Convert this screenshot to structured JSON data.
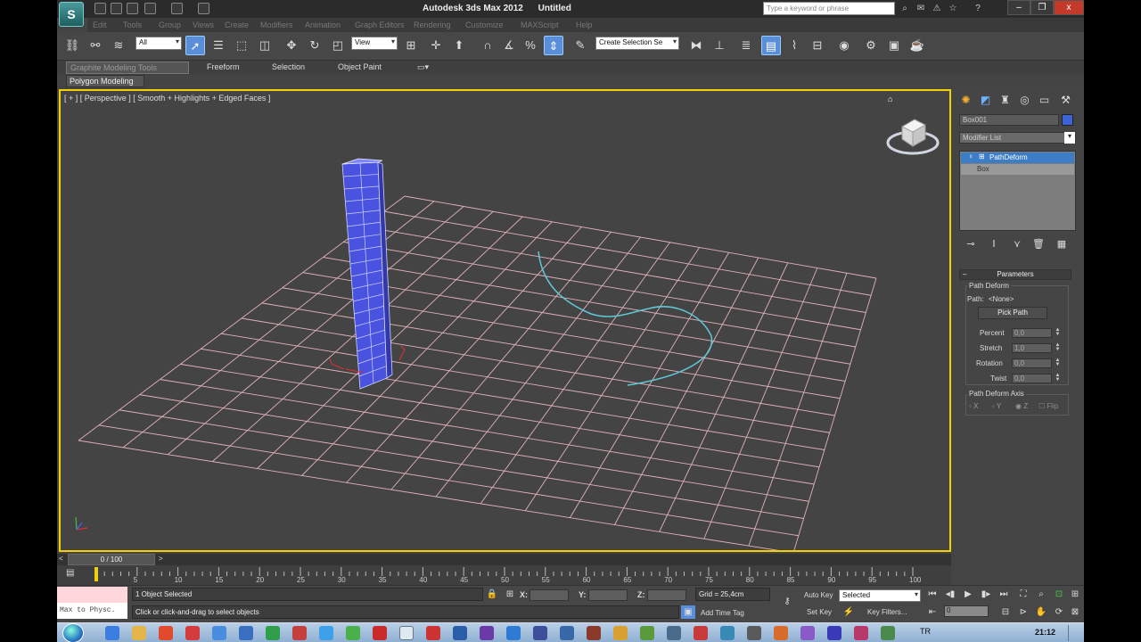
{
  "window": {
    "app_name": "Autodesk 3ds Max 2012",
    "doc_name": "Untitled",
    "search_placeholder": "Type a keyword or phrase",
    "logo_glyph": "S",
    "close_label": "x"
  },
  "menubar": {
    "items": [
      "Edit",
      "Tools",
      "Group",
      "Views",
      "Create",
      "Modifiers",
      "Animation",
      "Graph Editors",
      "Rendering",
      "Customize",
      "MAXScript",
      "Help"
    ]
  },
  "toolbar": {
    "selection_filter": "All",
    "reference_coord": "View",
    "named_selection": "Create Selection Se"
  },
  "ribbon": {
    "tabs": [
      "Graphite Modeling Tools",
      "Freeform",
      "Selection",
      "Object Paint"
    ],
    "sub_label": "Polygon Modeling"
  },
  "viewport": {
    "label": "[ + ] [ Perspective ] [ Smooth + Highlights + Edged Faces ]"
  },
  "command_panel": {
    "object_name": "Box001",
    "object_color": "#3d63d8",
    "modifier_list": "Modifier List",
    "stack": [
      "PathDeform",
      "Box"
    ],
    "parameters_title": "Parameters",
    "path_deform_group": "Path Deform",
    "path_label": "Path:",
    "path_value": "<None>",
    "pick_path_label": "Pick Path",
    "percent_label": "Percent",
    "percent_value": "0,0",
    "stretch_label": "Stretch",
    "stretch_value": "1,0",
    "rotation_label": "Rotation",
    "rotation_value": "0,0",
    "twist_label": "Twist",
    "twist_value": "0,0",
    "axis_group": "Path Deform Axis",
    "axis_x": "X",
    "axis_y": "Y",
    "axis_z": "Z",
    "flip_label": "Flip"
  },
  "timeline": {
    "frame_display": "0 / 100",
    "ticks": [
      "5",
      "10",
      "15",
      "20",
      "25",
      "30",
      "35",
      "40",
      "45",
      "50",
      "55",
      "60",
      "65",
      "70",
      "75",
      "80",
      "85",
      "90",
      "95",
      "100"
    ]
  },
  "status": {
    "maxscript_text": "Max to Physc.",
    "selection_status": "1 Object Selected",
    "prompt": "Click or click-and-drag to select objects",
    "x_label": "X:",
    "y_label": "Y:",
    "z_label": "Z:",
    "grid": "Grid = 25,4cm",
    "auto_key": "Auto Key",
    "selected_dd": "Selected",
    "set_key": "Set Key",
    "key_filters": "Key Filters...",
    "add_time_tag": "Add Time Tag",
    "frame_field": "0"
  },
  "taskbar": {
    "language": "TR",
    "clock": "21:12"
  },
  "colors": {
    "viewport_border": "#f5d000",
    "grid_line": "#e8b8c0",
    "box_blue": "#4a52e0",
    "spline_cyan": "#5fc8d8",
    "selected_modifier": "#3d7dc8"
  }
}
